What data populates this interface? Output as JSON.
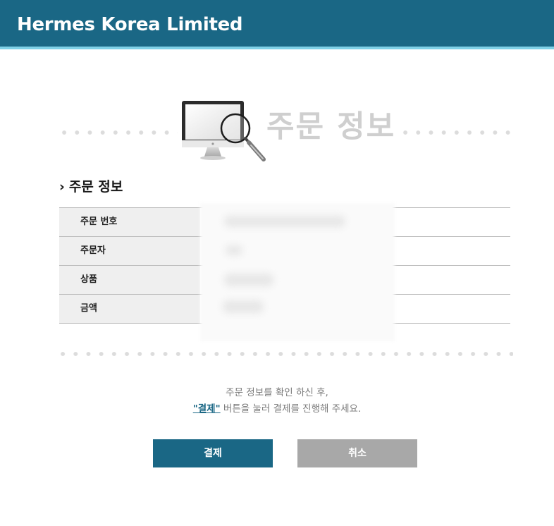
{
  "header": {
    "brand": "Hermes Korea Limited",
    "bg_color": "#1a6785",
    "accent_color": "#7fd0e6"
  },
  "hero": {
    "icon": "monitor-magnifier-icon",
    "title": "주문 정보"
  },
  "section": {
    "chevron": "›",
    "title": "주문 정보"
  },
  "order_info": {
    "rows": [
      {
        "label": "주문 번호",
        "value": ""
      },
      {
        "label": "주문자",
        "value": ""
      },
      {
        "label": "상품",
        "value": ""
      },
      {
        "label": "금액",
        "value": ""
      }
    ]
  },
  "notice": {
    "line1": "주문 정보를 확인 하신 후,",
    "line2_highlight": "\"결제\"",
    "line2_rest": " 버튼을 눌러 결제를 진행해 주세요."
  },
  "buttons": {
    "pay_label": "결제",
    "cancel_label": "취소",
    "pay_color": "#1a6785",
    "cancel_color": "#a8a8a8"
  }
}
